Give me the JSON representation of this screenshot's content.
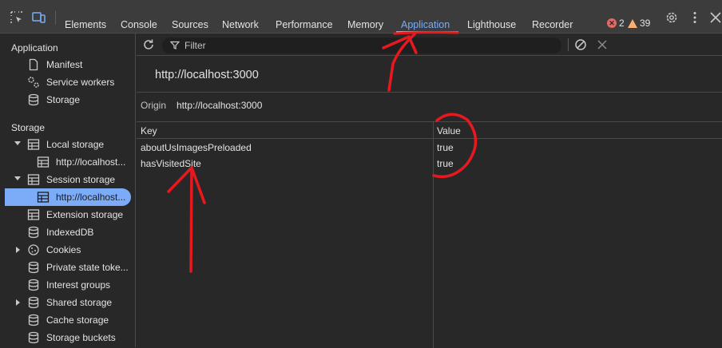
{
  "toolbar": {
    "tabs": [
      {
        "label": "Elements"
      },
      {
        "label": "Console"
      },
      {
        "label": "Sources"
      },
      {
        "label": "Network"
      },
      {
        "label": "Performance"
      },
      {
        "label": "Memory"
      },
      {
        "label": "Application"
      },
      {
        "label": "Lighthouse"
      },
      {
        "label": "Recorder"
      }
    ],
    "active_tab": "Application",
    "error_count": "2",
    "warning_count": "39"
  },
  "sidebar": {
    "application_title": "Application",
    "application_items": [
      {
        "label": "Manifest",
        "icon": "document-icon"
      },
      {
        "label": "Service workers",
        "icon": "gears-icon"
      },
      {
        "label": "Storage",
        "icon": "database-icon"
      }
    ],
    "storage_title": "Storage",
    "storage_items": [
      {
        "label": "Local storage",
        "icon": "table-icon",
        "expanded": true
      },
      {
        "label": "http://localhost...",
        "icon": "table-icon",
        "child": true
      },
      {
        "label": "Session storage",
        "icon": "table-icon",
        "expanded": true
      },
      {
        "label": "http://localhost...",
        "icon": "table-icon",
        "child": true,
        "selected": true
      },
      {
        "label": "Extension storage",
        "icon": "table-icon"
      },
      {
        "label": "IndexedDB",
        "icon": "database-icon"
      },
      {
        "label": "Cookies",
        "icon": "cookie-icon",
        "collapsed": true
      },
      {
        "label": "Private state toke...",
        "icon": "database-icon"
      },
      {
        "label": "Interest groups",
        "icon": "database-icon"
      },
      {
        "label": "Shared storage",
        "icon": "database-icon",
        "collapsed": true
      },
      {
        "label": "Cache storage",
        "icon": "database-icon"
      },
      {
        "label": "Storage buckets",
        "icon": "database-icon"
      }
    ]
  },
  "main": {
    "filter_placeholder": "Filter",
    "origin_heading": "http://localhost:3000",
    "origin_label": "Origin",
    "origin_value": "http://localhost:3000",
    "columns": [
      "Key",
      "Value"
    ],
    "rows": [
      {
        "key": "aboutUsImagesPreloaded",
        "value": "true"
      },
      {
        "key": "hasVisitedSite",
        "value": "true"
      }
    ]
  },
  "colors": {
    "accent": "#7cacf8",
    "annotation": "#e8191e",
    "background": "#282828"
  }
}
